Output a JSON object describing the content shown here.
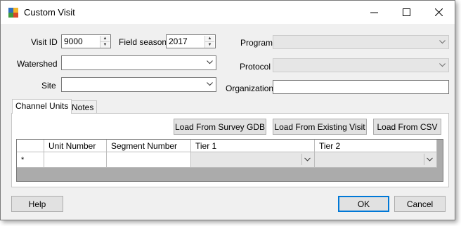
{
  "window": {
    "title": "Custom Visit",
    "minimize_glyph": "—",
    "maximize_glyph": "☐",
    "close_glyph": "✕"
  },
  "form": {
    "visit_id": {
      "label": "Visit ID",
      "value": "9000"
    },
    "field_season": {
      "label": "Field season",
      "value": "2017"
    },
    "watershed": {
      "label": "Watershed",
      "value": ""
    },
    "site": {
      "label": "Site",
      "value": ""
    },
    "program": {
      "label": "Program",
      "value": ""
    },
    "protocol": {
      "label": "Protocol",
      "value": ""
    },
    "organization": {
      "label": "Organization",
      "value": ""
    }
  },
  "tabs": [
    {
      "label": "Channel Units"
    },
    {
      "label": "Notes"
    }
  ],
  "buttons": {
    "load_gdb": "Load From Survey GDB",
    "load_visit": "Load From Existing Visit",
    "load_csv": "Load From CSV",
    "help": "Help",
    "ok": "OK",
    "cancel": "Cancel"
  },
  "grid": {
    "columns": [
      "Unit Number",
      "Segment Number",
      "Tier 1",
      "Tier 2"
    ],
    "new_row_marker": "*"
  },
  "colors": {
    "accent": "#0078d7",
    "window_bg": "#f0f0f0",
    "grid_bg": "#ababab"
  }
}
